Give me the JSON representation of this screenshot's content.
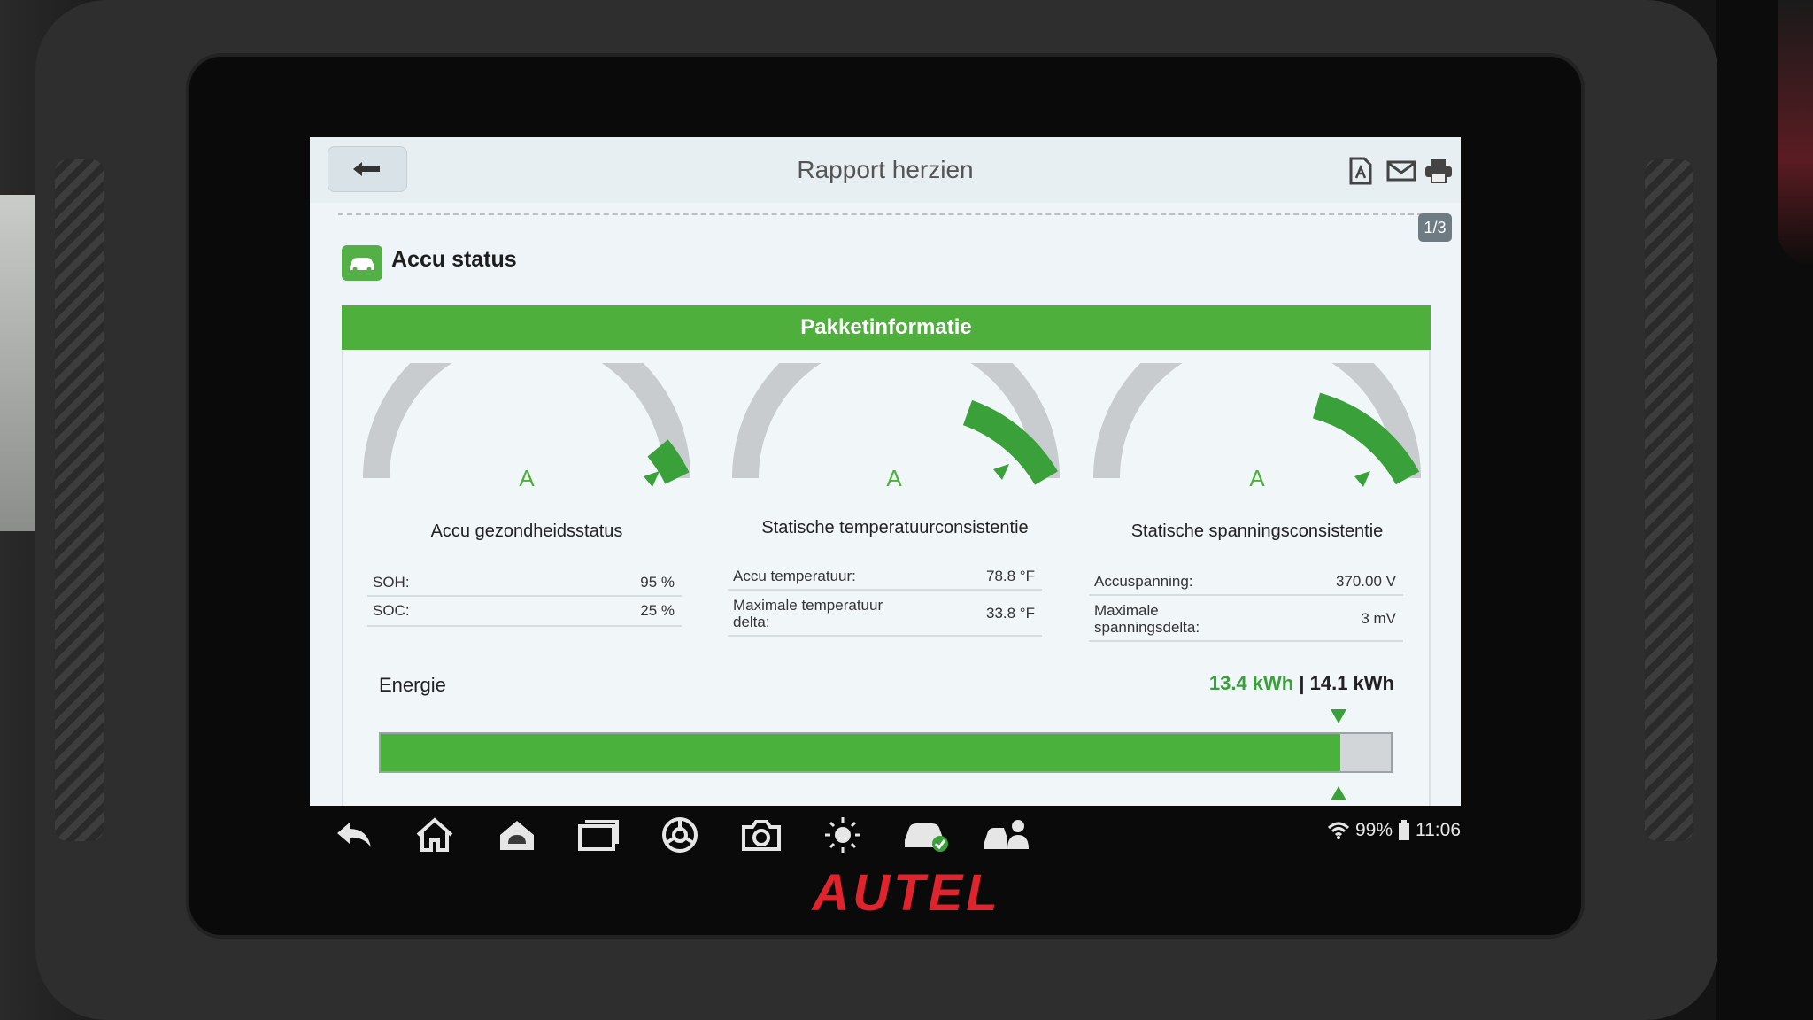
{
  "header": {
    "title": "Rapport herzien",
    "page_indicator": "1/3",
    "icons": [
      "back-arrow-icon",
      "pdf-icon",
      "mail-icon",
      "print-icon"
    ]
  },
  "section": {
    "title": "Accu status",
    "icon": "car-battery-icon"
  },
  "panel": {
    "title": "Pakketinformatie"
  },
  "gauges": [
    {
      "label": "Accu gezondheidsstatus",
      "grade": "A",
      "level": 0.95,
      "rows": [
        {
          "key": "SOH:",
          "value": "95 %"
        },
        {
          "key": "SOC:",
          "value": "25 %"
        }
      ]
    },
    {
      "label": "Statische temperatuurconsistentie",
      "grade": "A",
      "level": 0.9,
      "rows": [
        {
          "key": "Accu temperatuur:",
          "value": "78.8 °F"
        },
        {
          "key": "Maximale temperatuur delta:",
          "value": "33.8 °F"
        }
      ]
    },
    {
      "label": "Statische spanningsconsistentie",
      "grade": "A",
      "level": 0.9,
      "rows": [
        {
          "key": "Accuspanning:",
          "value": "370.00 V"
        },
        {
          "key": "Maximale spanningsdelta:",
          "value": "3 mV"
        }
      ]
    }
  ],
  "energy": {
    "label": "Energie",
    "current": "13.4 kWh",
    "separator": "|",
    "max": "14.1 kWh",
    "fraction": 0.95
  },
  "navbar": {
    "icons": [
      "return-icon",
      "home-icon",
      "android-icon",
      "recent-apps-icon",
      "browser-icon",
      "camera-icon",
      "brightness-icon",
      "vehicle-check-icon",
      "technician-icon"
    ]
  },
  "status": {
    "battery": "99%",
    "time": "11:06"
  },
  "brand": "AUTEL",
  "colors": {
    "accent": "#4eaf3d",
    "gauge_track": "#c8ccce",
    "brand": "#e0242d"
  }
}
